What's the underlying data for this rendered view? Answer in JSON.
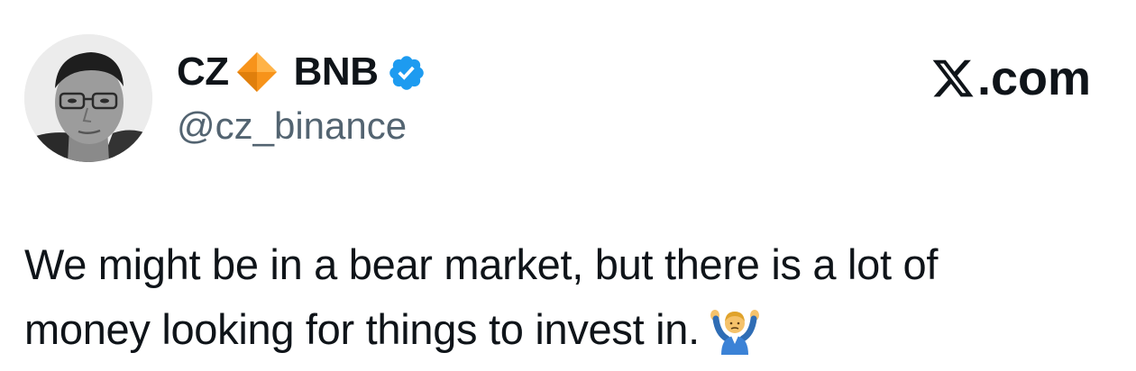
{
  "author": {
    "display_name_part1": "CZ",
    "display_name_part2": "BNB",
    "handle": "@cz_binance",
    "badge_icon": "orange-diamond-icon",
    "verified_icon": "verified-badge-icon",
    "verified_color": "#1d9bf0",
    "diamond_color": "#f7931a"
  },
  "brand": {
    "logo_icon": "x-logo-icon",
    "label": ".com"
  },
  "tweet": {
    "line1": "We might be in a bear market, but there is a lot of",
    "line2": "money looking for things to invest in.",
    "emoji_icon": "man-shrugging-emoji-icon"
  }
}
